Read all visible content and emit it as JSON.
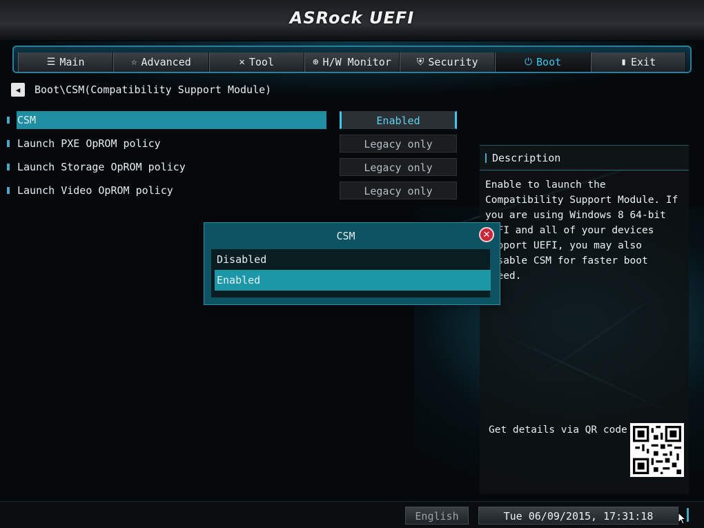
{
  "header": {
    "logo": "ASRock UEFI"
  },
  "tabs": [
    {
      "label": "Main",
      "icon": "list-icon",
      "glyph": "☰"
    },
    {
      "label": "Advanced",
      "icon": "star-icon",
      "glyph": "☆"
    },
    {
      "label": "Tool",
      "icon": "tools-icon",
      "glyph": "✕"
    },
    {
      "label": "H/W Monitor",
      "icon": "monitor-icon",
      "glyph": "⊕"
    },
    {
      "label": "Security",
      "icon": "shield-icon",
      "glyph": "⛨"
    },
    {
      "label": "Boot",
      "icon": "power-icon",
      "glyph": "⏻"
    },
    {
      "label": "Exit",
      "icon": "exit-icon",
      "glyph": "▮"
    }
  ],
  "active_tab": "Boot",
  "breadcrumb": "Boot\\CSM(Compatibility Support Module)",
  "settings": [
    {
      "label": "CSM",
      "value": "Enabled"
    },
    {
      "label": "Launch PXE OpROM policy",
      "value": "Legacy only"
    },
    {
      "label": "Launch Storage OpROM policy",
      "value": "Legacy only"
    },
    {
      "label": "Launch Video OpROM policy",
      "value": "Legacy only"
    }
  ],
  "description": {
    "title": "Description",
    "text": "Enable to launch the Compatibility Support Module. If you are using Windows 8 64-bit UEFI and all of your devices support UEFI, you may also disable CSM for faster boot speed.",
    "qr_label": "Get details via QR code"
  },
  "modal": {
    "title": "CSM",
    "close_glyph": "✕",
    "options": [
      "Disabled",
      "Enabled"
    ],
    "selected": "Enabled"
  },
  "footer": {
    "language": "English",
    "datetime": "Tue 06/09/2015, 17:31:18"
  },
  "colors": {
    "accent": "#3cc6f0",
    "selection": "#1f8ea0",
    "modal_bg": "#0d5362",
    "close": "#c8283a"
  }
}
